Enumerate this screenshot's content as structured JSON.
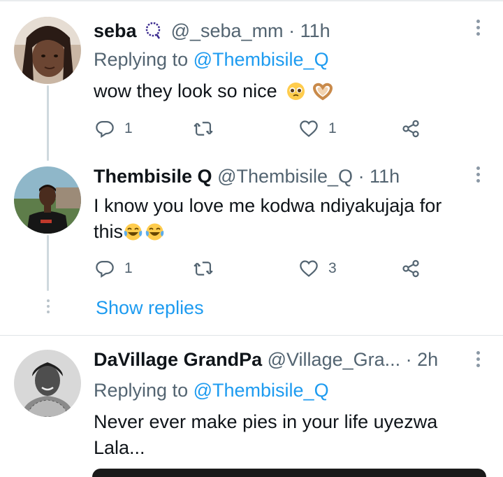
{
  "tweets": [
    {
      "name": "seba",
      "handle": "@_seba_mm",
      "time": "· 11h",
      "reply_prefix": "Replying to ",
      "reply_to": "@Thembisile_Q",
      "text": "wow they look so nice",
      "actions": {
        "replies": "1",
        "likes": "1"
      }
    },
    {
      "name": "Thembisile Q",
      "handle": "@Thembisile_Q",
      "time": "· 11h",
      "text_line1": "I know you love me kodwa ndiyakujaja for",
      "text_line2": "this",
      "actions": {
        "replies": "1",
        "likes": "3"
      }
    },
    {
      "name": "DaVillage GrandPa",
      "handle": "@Village_Gra...",
      "time": "· 2h",
      "reply_prefix": "Replying to ",
      "reply_to": "@Thembisile_Q",
      "text_line1": "Never ever make pies in your life uyezwa",
      "text_line2": "Lala..."
    }
  ],
  "show_replies_label": "Show replies",
  "colors": {
    "link": "#1d9bf0",
    "secondary_text": "#536471",
    "thread_line": "#cfd9de"
  }
}
